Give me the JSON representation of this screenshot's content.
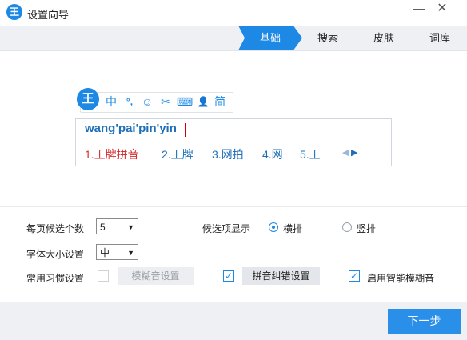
{
  "window": {
    "title": "设置向导",
    "logo_text": "王",
    "minimize_glyph": "—",
    "close_glyph": "✕"
  },
  "tabs": [
    {
      "label": "基础",
      "active": true
    },
    {
      "label": "搜索"
    },
    {
      "label": "皮肤"
    },
    {
      "label": "词库"
    }
  ],
  "ime_preview": {
    "logo_text": "王",
    "toolbar_items": [
      "中",
      "°,",
      "☺",
      "✂",
      "⌨",
      "👤",
      "简"
    ],
    "composition": "wang'pai'pin'yin",
    "candidates": [
      "1.王牌拼音",
      "2.王牌",
      "3.网拍",
      "4.网",
      "5.王"
    ],
    "prev_arrow": "◀",
    "next_arrow": "▶"
  },
  "settings": {
    "per_page": {
      "label": "每页候选个数",
      "value": "5"
    },
    "display": {
      "label": "候选项显示",
      "options": [
        {
          "label": "横排",
          "selected": true
        },
        {
          "label": "竖排",
          "selected": false
        }
      ]
    },
    "font_size": {
      "label": "字体大小设置",
      "value": "中"
    },
    "habits": {
      "label": "常用习惯设置",
      "fuzzy_button": "模糊音设置",
      "correction_button": "拼音纠错设置",
      "smart_fuzzy_label": "启用智能模糊音"
    }
  },
  "footer": {
    "next_label": "下一步"
  },
  "colors": {
    "accent": "#1e88e5",
    "candidate_first": "#d32f2f",
    "candidate_text": "#1e6fb8"
  }
}
